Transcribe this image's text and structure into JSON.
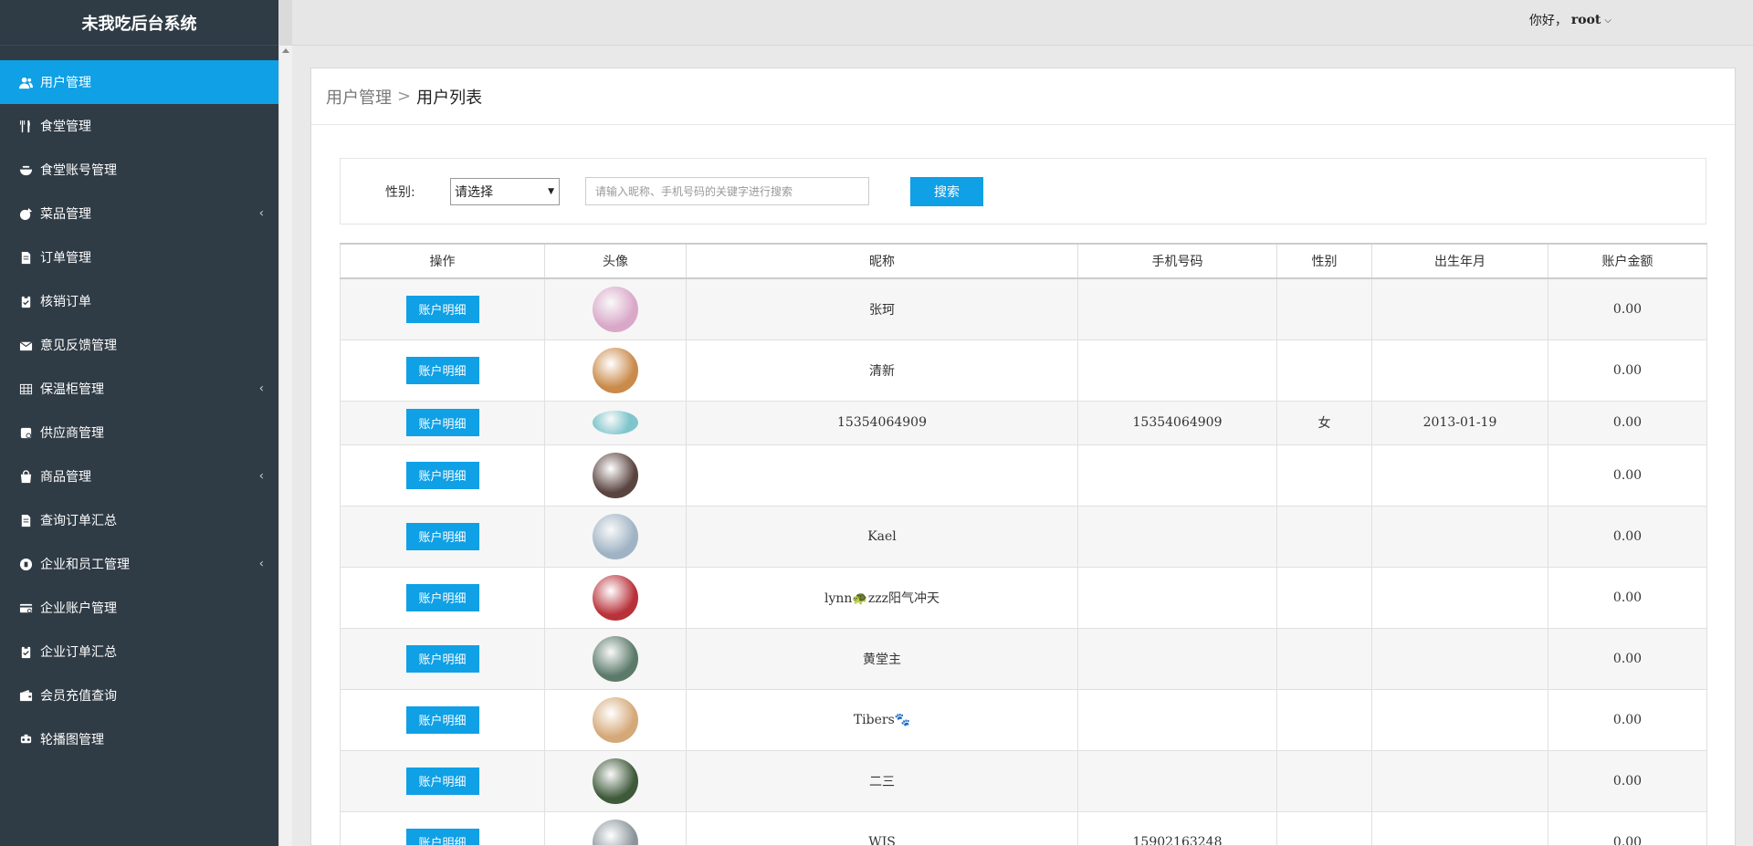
{
  "app": {
    "title": "未我吃后台系统"
  },
  "header": {
    "greeting": "你好，",
    "username": "root"
  },
  "sidebar": {
    "items": [
      {
        "label": "用户管理",
        "icon": "users-icon",
        "active": true,
        "has_children": false
      },
      {
        "label": "食堂管理",
        "icon": "utensils-icon",
        "active": false,
        "has_children": false
      },
      {
        "label": "食堂账号管理",
        "icon": "bowl-icon",
        "active": false,
        "has_children": false
      },
      {
        "label": "菜品管理",
        "icon": "dish-icon",
        "active": false,
        "has_children": true
      },
      {
        "label": "订单管理",
        "icon": "document-icon",
        "active": false,
        "has_children": false
      },
      {
        "label": "核销订单",
        "icon": "clipboard-icon",
        "active": false,
        "has_children": false
      },
      {
        "label": "意见反馈管理",
        "icon": "envelope-icon",
        "active": false,
        "has_children": false
      },
      {
        "label": "保温柜管理",
        "icon": "grid-icon",
        "active": false,
        "has_children": true
      },
      {
        "label": "供应商管理",
        "icon": "supplier-icon",
        "active": false,
        "has_children": false
      },
      {
        "label": "商品管理",
        "icon": "bag-icon",
        "active": false,
        "has_children": true
      },
      {
        "label": "查询订单汇总",
        "icon": "document-icon",
        "active": false,
        "has_children": false
      },
      {
        "label": "企业和员工管理",
        "icon": "company-icon",
        "active": false,
        "has_children": true
      },
      {
        "label": "企业账户管理",
        "icon": "card-icon",
        "active": false,
        "has_children": false
      },
      {
        "label": "企业订单汇总",
        "icon": "clipboard-icon",
        "active": false,
        "has_children": false
      },
      {
        "label": "会员充值查询",
        "icon": "wallet-icon",
        "active": false,
        "has_children": false
      },
      {
        "label": "轮播图管理",
        "icon": "carousel-icon",
        "active": false,
        "has_children": false
      }
    ]
  },
  "breadcrumb": {
    "parent": "用户管理",
    "separator": ">",
    "current": "用户列表"
  },
  "search": {
    "gender_label": "性别:",
    "gender_selected": "请选择",
    "keyword_placeholder": "请输入昵称、手机号码的关键字进行搜索",
    "keyword_value": "",
    "button_label": "搜索"
  },
  "table": {
    "columns": [
      "操作",
      "头像",
      "昵称",
      "手机号码",
      "性别",
      "出生年月",
      "账户金额"
    ],
    "action_label": "账户明细",
    "rows": [
      {
        "nickname": "张珂",
        "phone": "",
        "gender": "",
        "birth": "",
        "balance": "0.00",
        "avatar_color": "#d9a8c8"
      },
      {
        "nickname": "清新",
        "phone": "",
        "gender": "",
        "birth": "",
        "balance": "0.00",
        "avatar_color": "#c98a4a"
      },
      {
        "nickname": "15354064909",
        "phone": "15354064909",
        "gender": "女",
        "birth": "2013-01-19",
        "balance": "0.00",
        "avatar_color": "#7fc6cc"
      },
      {
        "nickname": "",
        "phone": "",
        "gender": "",
        "birth": "",
        "balance": "0.00",
        "avatar_color": "#5a4440"
      },
      {
        "nickname": "Kael",
        "phone": "",
        "gender": "",
        "birth": "",
        "balance": "0.00",
        "avatar_color": "#9fb3c4"
      },
      {
        "nickname": "lynn🐢zzz阳气冲天",
        "phone": "",
        "gender": "",
        "birth": "",
        "balance": "0.00",
        "avatar_color": "#b8323a"
      },
      {
        "nickname": "黄堂主",
        "phone": "",
        "gender": "",
        "birth": "",
        "balance": "0.00",
        "avatar_color": "#5b7a6a"
      },
      {
        "nickname": "Tibers🐾",
        "phone": "",
        "gender": "",
        "birth": "",
        "balance": "0.00",
        "avatar_color": "#d4a877"
      },
      {
        "nickname": "二三",
        "phone": "",
        "gender": "",
        "birth": "",
        "balance": "0.00",
        "avatar_color": "#3f5a3a"
      },
      {
        "nickname": "WJS",
        "phone": "15902163248",
        "gender": "",
        "birth": "",
        "balance": "0.00",
        "avatar_color": "#8a949a"
      }
    ]
  }
}
